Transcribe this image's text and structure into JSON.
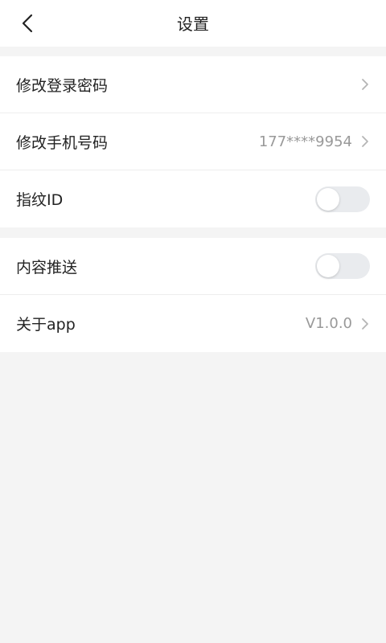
{
  "header": {
    "title": "设置",
    "back_icon": "chevron-left-icon"
  },
  "groups": [
    {
      "items": [
        {
          "label": "修改登录密码",
          "value": "",
          "control": "chevron"
        },
        {
          "label": "修改手机号码",
          "value": "177****9954",
          "control": "chevron"
        },
        {
          "label": "指纹ID",
          "value": "",
          "control": "toggle",
          "on": false
        }
      ]
    },
    {
      "items": [
        {
          "label": "内容推送",
          "value": "",
          "control": "toggle",
          "on": false
        },
        {
          "label": "关于app",
          "value": "V1.0.0",
          "control": "chevron"
        }
      ]
    }
  ],
  "colors": {
    "page_background": "#f4f4f4",
    "card_background": "#ffffff",
    "secondary_text": "#999999",
    "toggle_off_track": "#e9ebee"
  }
}
